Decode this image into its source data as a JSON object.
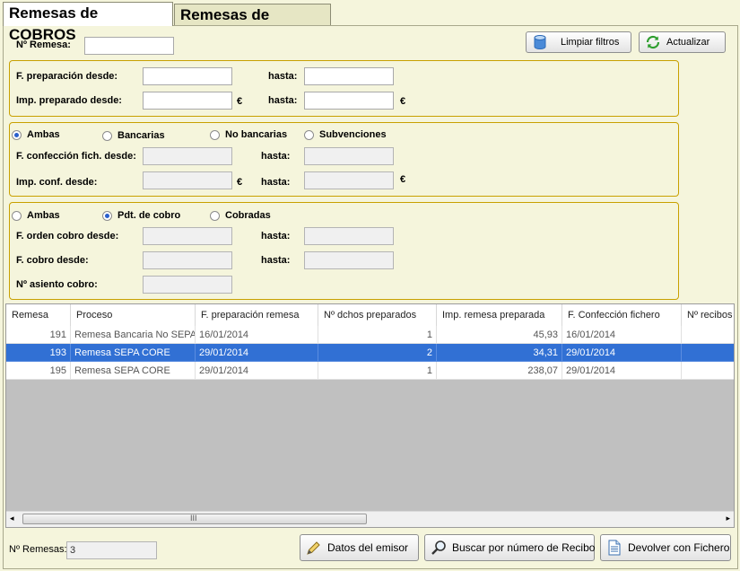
{
  "tabs": [
    {
      "label": "Remesas de COBROS",
      "active": true
    },
    {
      "label": "Remesas de PAGOS",
      "active": false
    }
  ],
  "top": {
    "remesa_label": "Nº Remesa:",
    "remesa_value": "",
    "limpiar_label": "Limpiar filtros",
    "actualizar_label": "Actualizar"
  },
  "group1": {
    "fprep_desde_label": "F. preparación desde:",
    "hasta1_label": "hasta:",
    "imp_desde_label": "Imp. preparado desde:",
    "hasta2_label": "hasta:",
    "currency": "€"
  },
  "group2": {
    "radio_ambas": "Ambas",
    "radio_bancarias": "Bancarias",
    "radio_no_bancarias": "No bancarias",
    "radio_subvenciones": "Subvenciones",
    "selected": "Ambas",
    "fconf_desde_label": "F. confección fich. desde:",
    "hasta1_label": "hasta:",
    "impconf_desde_label": "Imp. conf. desde:",
    "hasta2_label": "hasta:",
    "currency": "€"
  },
  "group3": {
    "radio_ambas": "Ambas",
    "radio_pdt": "Pdt. de cobro",
    "radio_cobradas": "Cobradas",
    "selected": "Pdt. de cobro",
    "forden_desde_label": "F. orden cobro desde:",
    "hasta1_label": "hasta:",
    "fcobro_desde_label": "F. cobro desde:",
    "hasta2_label": "hasta:",
    "asiento_label": "Nº asiento cobro:"
  },
  "grid": {
    "columns": [
      "Remesa",
      "Proceso",
      "F. preparación remesa",
      "Nº dchos preparados",
      "Imp. remesa preparada",
      "F. Confección fichero",
      "Nº recibos"
    ],
    "rows": [
      {
        "remesa": "191",
        "proceso": "Remesa Bancaria No SEPA",
        "fprep": "16/01/2014",
        "dchos": "1",
        "importe": "45,93",
        "fconf": "16/01/2014",
        "recibos": "",
        "selected": false
      },
      {
        "remesa": "193",
        "proceso": "Remesa SEPA CORE",
        "fprep": "29/01/2014",
        "dchos": "2",
        "importe": "34,31",
        "fconf": "29/01/2014",
        "recibos": "",
        "selected": true
      },
      {
        "remesa": "195",
        "proceso": "Remesa SEPA CORE",
        "fprep": "29/01/2014",
        "dchos": "1",
        "importe": "238,07",
        "fconf": "29/01/2014",
        "recibos": "",
        "selected": false
      }
    ],
    "scroll_thumb_glyph": "III"
  },
  "footer": {
    "count_label": "Nº Remesas:",
    "count_value": "3",
    "datos_label": "Datos del emisor",
    "buscar_label": "Buscar por número de Recibo",
    "devolver_label": "Devolver con Fichero"
  },
  "icons": {
    "limpiar": "database-icon",
    "actualizar": "refresh-icon",
    "datos": "edit-icon",
    "buscar": "magnifier-icon",
    "devolver": "document-icon"
  },
  "colors": {
    "background": "#f5f5dc",
    "group_border": "#c8a000",
    "selection": "#3170d4"
  }
}
